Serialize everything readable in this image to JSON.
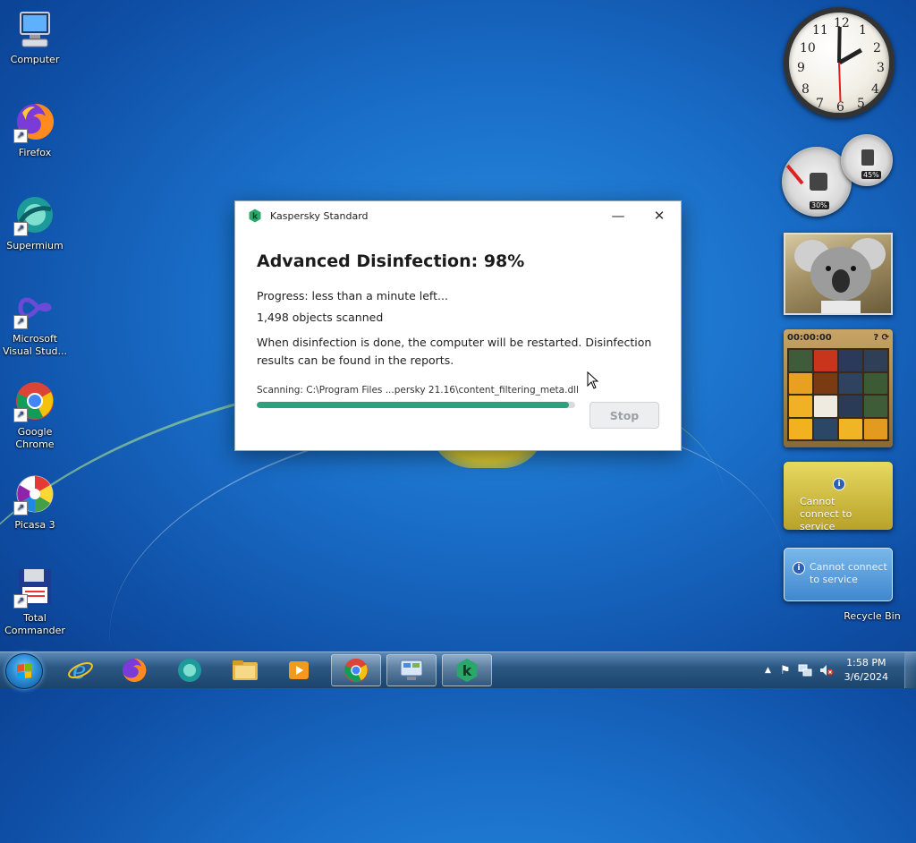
{
  "desktop": {
    "icons": [
      {
        "label": "Computer"
      },
      {
        "label": "Firefox"
      },
      {
        "label": "Supermium"
      },
      {
        "label": "Microsoft Visual Stud..."
      },
      {
        "label": "Google Chrome"
      },
      {
        "label": "Picasa 3"
      },
      {
        "label": "Total Commander"
      }
    ],
    "recycle_bin": "Recycle Bin"
  },
  "gadgets": {
    "clock": {
      "numbers": [
        "12",
        "1",
        "2",
        "3",
        "4",
        "5",
        "6",
        "7",
        "8",
        "9",
        "10",
        "11"
      ]
    },
    "cpu_meter": {
      "cpu": "30%",
      "memory": "45%"
    },
    "puzzle": {
      "timer": "00:00:00"
    },
    "weather": {
      "message": "Cannot connect to service"
    },
    "feed": {
      "message": "Cannot connect to service"
    }
  },
  "dialog": {
    "app_title": "Kaspersky Standard",
    "minimize": "—",
    "close": "✕",
    "heading": "Advanced Disinfection: 98%",
    "progress_text": "Progress: less than a minute left...",
    "objects_scanned": "1,498 objects scanned",
    "info_line1": "When disinfection is done, the computer will be restarted. Disinfection",
    "info_line2": "results can be found in the reports.",
    "scanning_text": "Scanning:  C:\\Program Files ...persky 21.16\\content_filtering_meta.dll",
    "progress_percent": 98,
    "stop_label": "Stop",
    "accent_color": "#2f9f7d"
  },
  "taskbar": {
    "apps": [
      "internet-explorer",
      "firefox",
      "supermium",
      "file-explorer",
      "media-player",
      "chrome",
      "control-panel",
      "kaspersky"
    ],
    "time": "1:58 PM",
    "date": "3/6/2024"
  }
}
